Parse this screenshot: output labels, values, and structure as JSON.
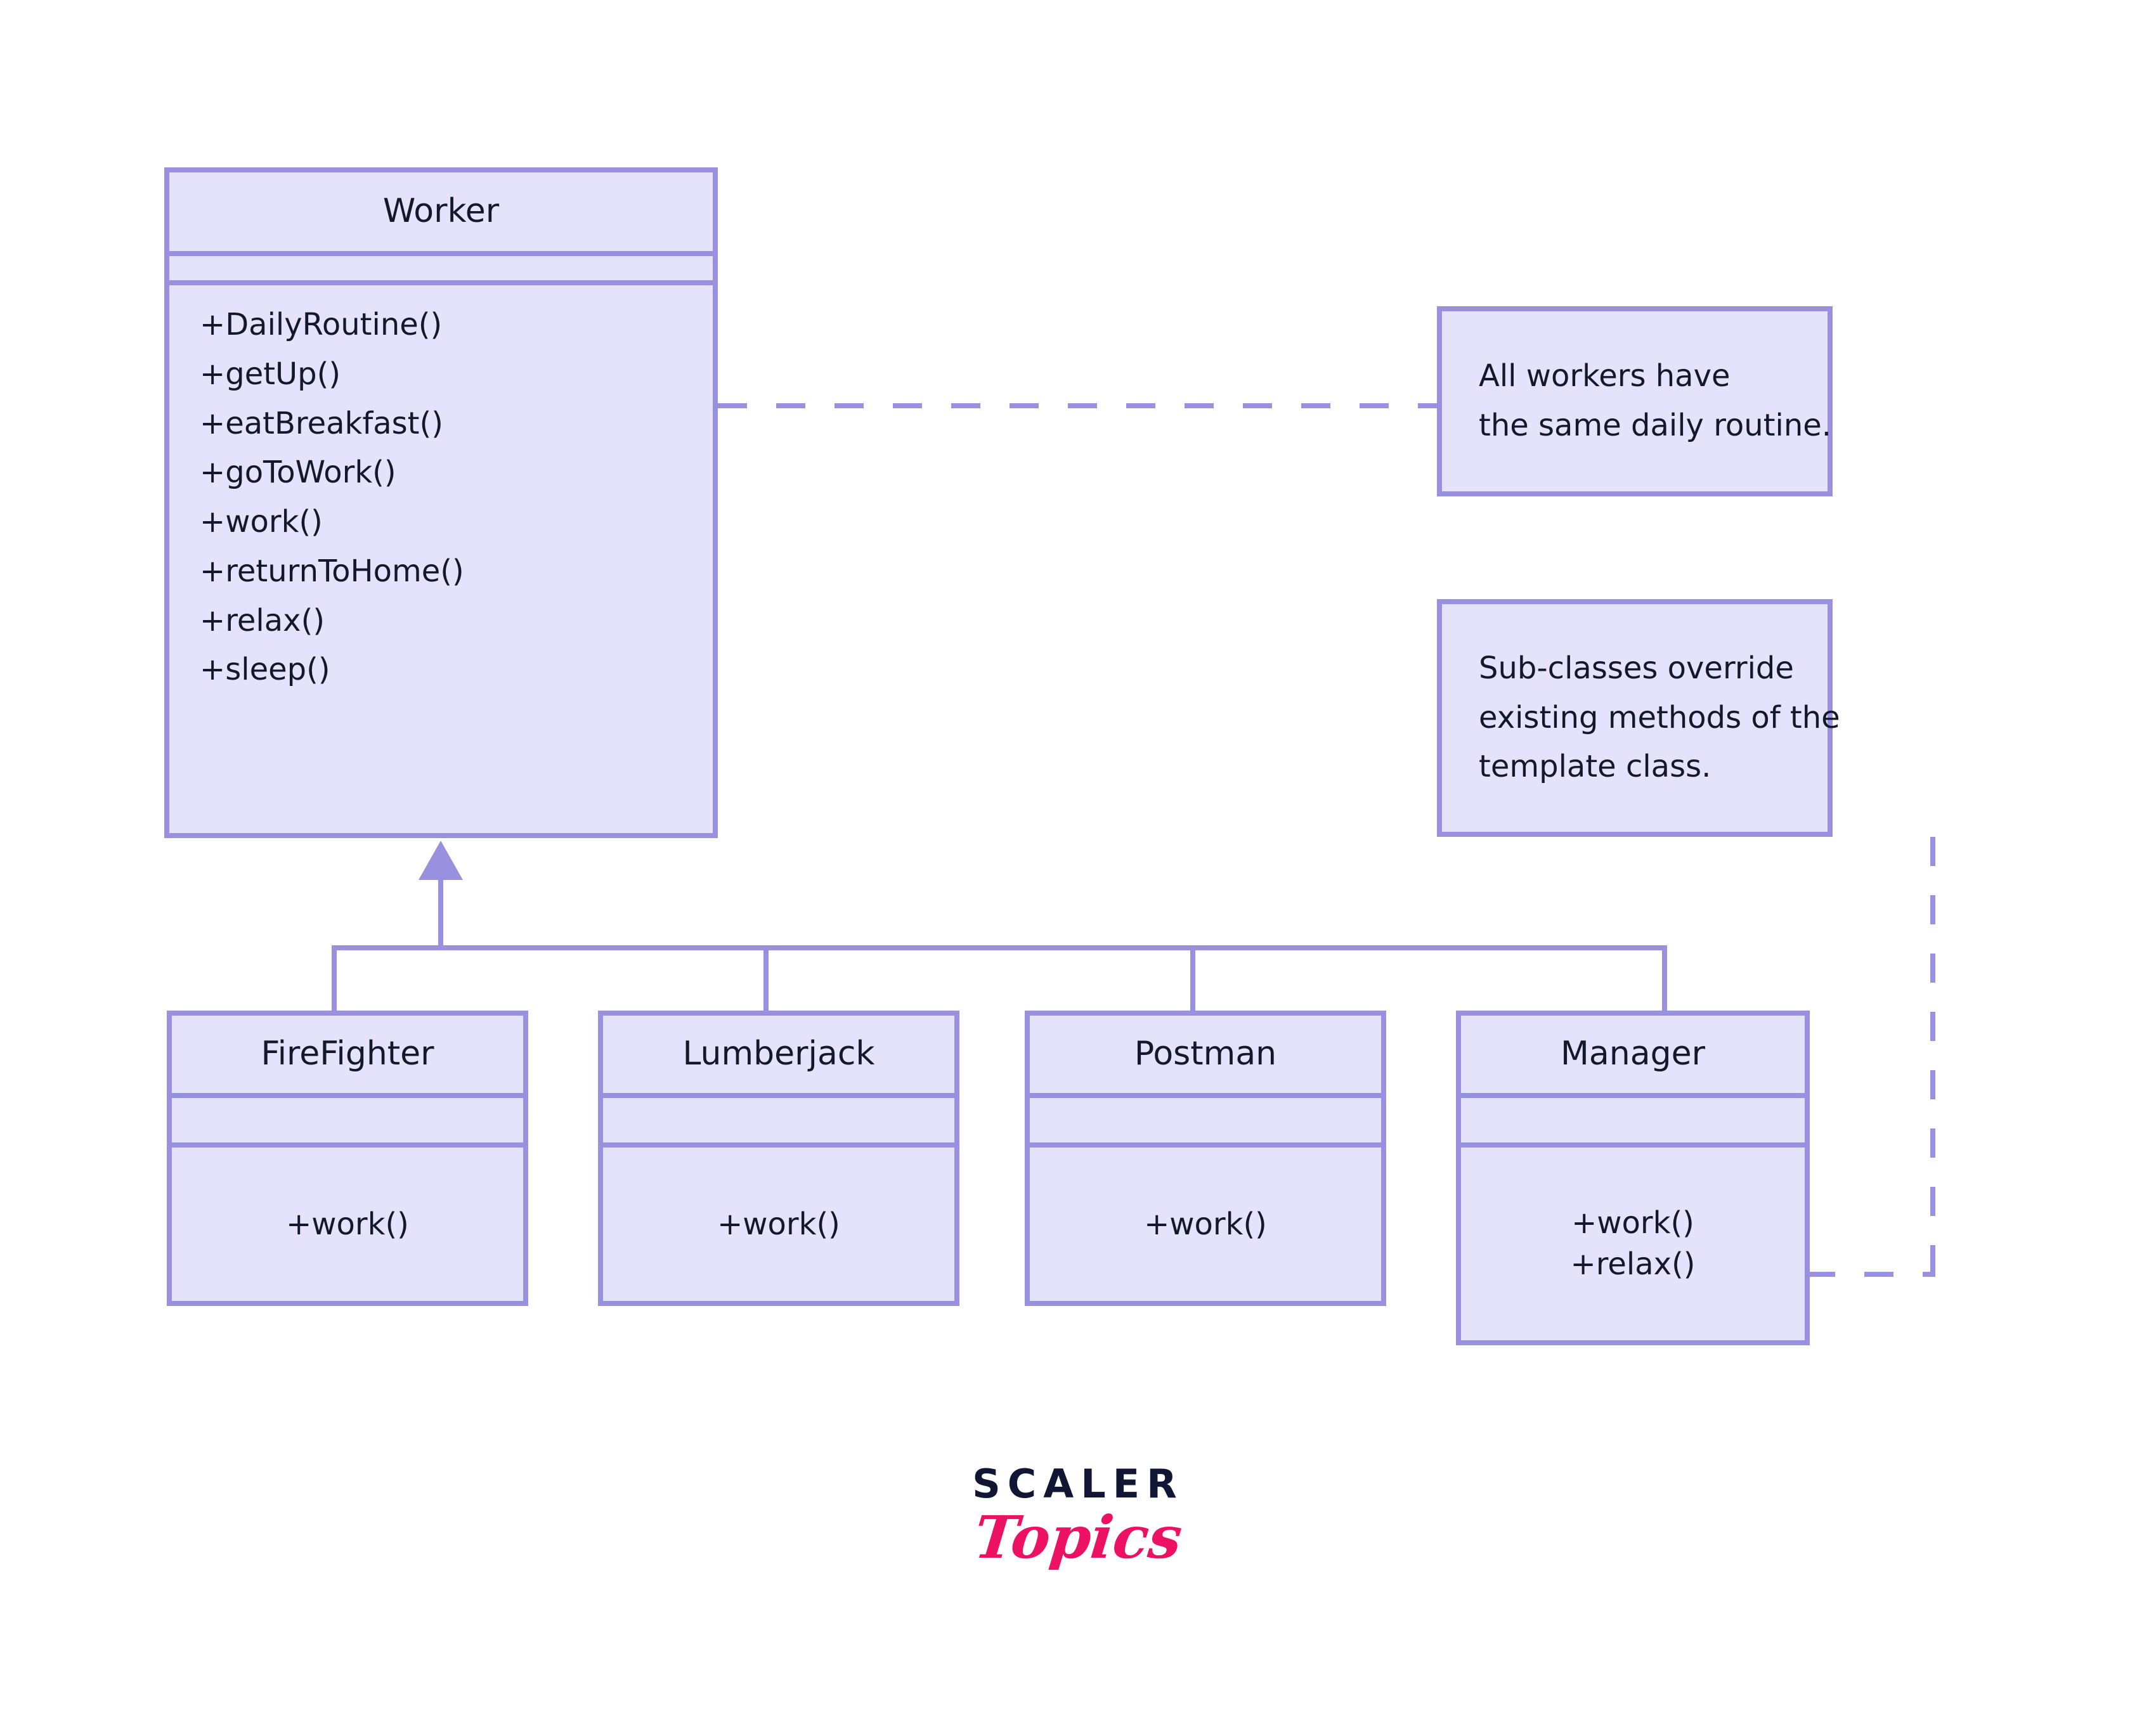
{
  "diagram": {
    "type": "uml-class-diagram",
    "title_text": "",
    "colors": {
      "box_fill": "#e5e3fb",
      "box_border": "#9a90e0",
      "text": "#14182b",
      "background": "#ffffff",
      "logo_dark": "#101634",
      "logo_pink": "#ec1163"
    },
    "base_class": {
      "name": "Worker",
      "attributes": [],
      "methods": [
        "+DailyRoutine()",
        "+getUp()",
        "+eatBreakfast()",
        "+goToWork()",
        "+work()",
        "+returnToHome()",
        "+relax()",
        "+sleep()"
      ]
    },
    "subclasses": [
      {
        "name": "FireFighter",
        "attributes": [],
        "methods": [
          "+work()"
        ]
      },
      {
        "name": "Lumberjack",
        "attributes": [],
        "methods": [
          "+work()"
        ]
      },
      {
        "name": "Postman",
        "attributes": [],
        "methods": [
          "+work()"
        ]
      },
      {
        "name": "Manager",
        "attributes": [],
        "methods": [
          "+work()",
          "+relax()"
        ]
      }
    ],
    "notes": [
      {
        "id": "note-daily-routine",
        "lines": [
          "All workers have",
          "the same daily routine."
        ],
        "attached_to": "Worker"
      },
      {
        "id": "note-override",
        "lines": [
          "Sub-classes override",
          "existing methods of the",
          "template class."
        ],
        "attached_to": "Manager"
      }
    ],
    "relationships": [
      {
        "type": "generalization",
        "from": "FireFighter",
        "to": "Worker"
      },
      {
        "type": "generalization",
        "from": "Lumberjack",
        "to": "Worker"
      },
      {
        "type": "generalization",
        "from": "Postman",
        "to": "Worker"
      },
      {
        "type": "generalization",
        "from": "Manager",
        "to": "Worker"
      },
      {
        "type": "note-link",
        "from": "note-daily-routine",
        "to": "Worker"
      },
      {
        "type": "note-link",
        "from": "note-override",
        "to": "Manager"
      }
    ]
  },
  "logo": {
    "primary": "SCALER",
    "secondary": "Topics"
  }
}
